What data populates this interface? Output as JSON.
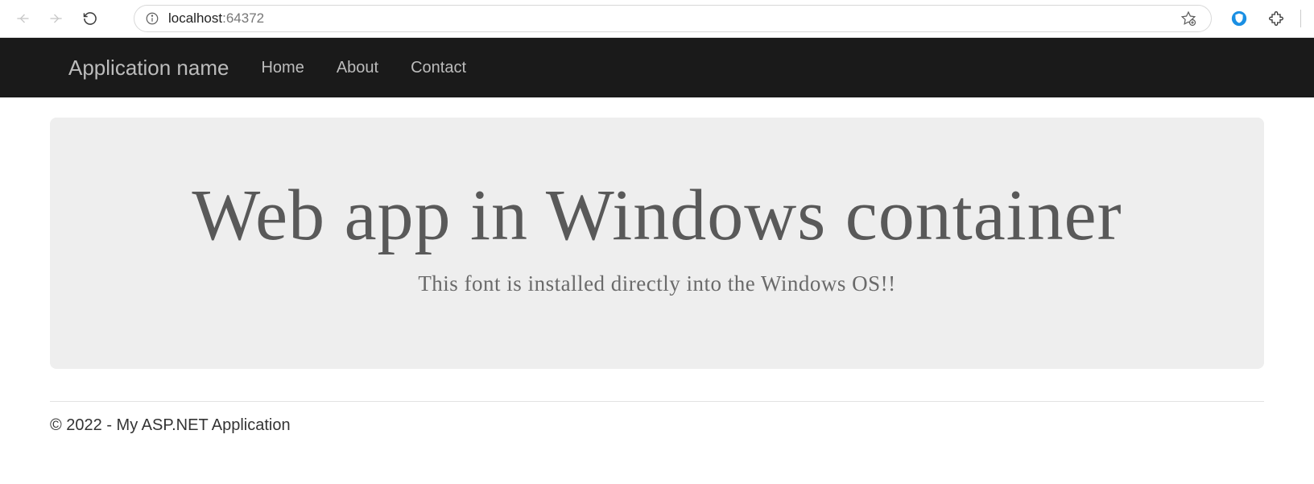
{
  "browser": {
    "url_host": "localhost",
    "url_port": ":64372"
  },
  "navbar": {
    "brand": "Application name",
    "links": [
      "Home",
      "About",
      "Contact"
    ]
  },
  "hero": {
    "title": "Web app in Windows container",
    "subtitle": "This font is installed directly into the Windows OS!!"
  },
  "footer": {
    "text": "© 2022 - My ASP.NET Application"
  }
}
